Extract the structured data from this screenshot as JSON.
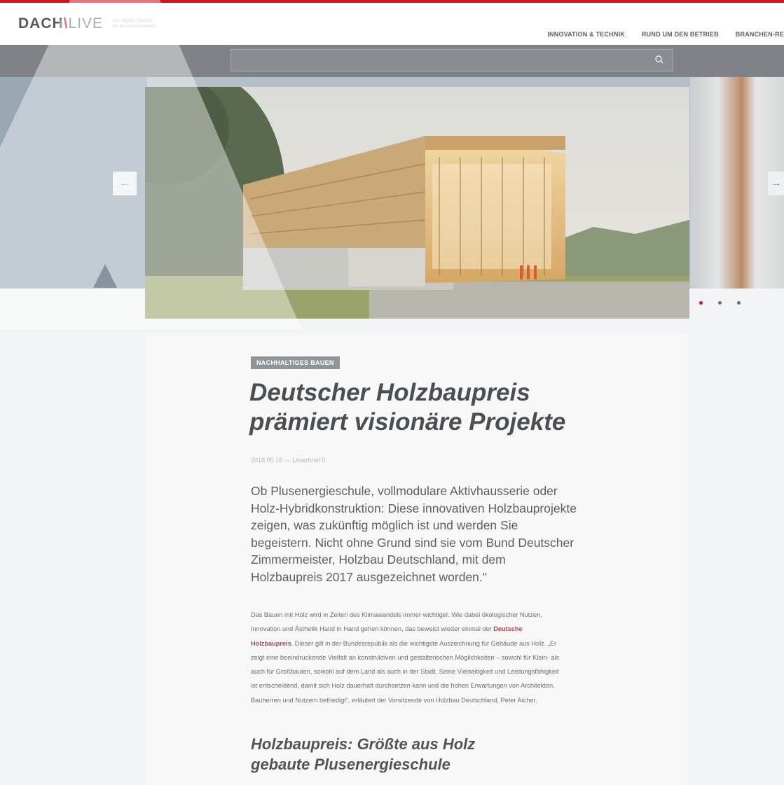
{
  "header": {
    "logo_primary": "DACH",
    "logo_slash": "\\",
    "logo_secondary": "LIVE",
    "logo_tagline_1": "Das digitale Zuhause",
    "logo_tagline_2": "für das Dachhandwerk",
    "nav": [
      {
        "label": "INNOVATION & TECHNIK"
      },
      {
        "label": "RUND UM DEN BETRIEB"
      },
      {
        "label": "BRANCHEN-RE"
      }
    ]
  },
  "search": {
    "placeholder": "",
    "value": ""
  },
  "carousel": {
    "prev_label": "←",
    "next_label": "→",
    "slides": 3,
    "active_slide": 1
  },
  "article": {
    "category": "NACHHALTIGES BAUEN",
    "title": "Deutscher Holzbaupreis prämiert visionäre Projekte",
    "date": "2018.05.18",
    "comments": "— Leserbrief 0",
    "lead": "Ob Plusenergieschule, vollmodulare Aktivhausserie oder Holz-Hybridkonstruktion: Diese innovativen Holzbauprojekte zeigen, was zukünftig möglich ist und werden Sie begeistern. Nicht ohne Grund sind sie vom Bund Deutscher Zimmermeister, Holzbau Deutschland, mit dem Holzbaupreis 2017 ausgezeichnet worden.\"",
    "body_before_link": "Das Bauen mit Holz wird in Zeiten des Klimawandels immer wichtiger. Wie dabei ökologischer Nutzen, Innovation und Ästhetik Hand in Hand gehen können, das beweist wieder einmal der ",
    "body_link": "Deutsche Holzbaupreis",
    "body_after_link": ". Dieser gilt in der Bundesrepublik als die wichtigste Auszeichnung für Gebäude aus Holz. „Er zeigt eine beeindruckende Vielfalt an konstruktiven und gestalterischen Möglichkeiten – sowohl für Klein- als auch für Großbauten, sowohl auf dem Land als auch in der Stadt. Seine Vielseitigkeit und Leistungsfähigkeit ist entscheidend, damit sich Holz dauerhaft durchsetzen kann und die hohen Erwartungen von Architekten, Bauherren und Nutzern befriedigt“, erläutert der Vorsitzende von Holzbau Deutschland, Peter Aicher.",
    "subheading": "Holzbaupreis: Größte aus Holz gebaute Plusenergieschule"
  },
  "colors": {
    "accent": "#d8111a",
    "nav_bar": "#7f8387",
    "hero_band": "#b4bfc8"
  },
  "icons": {
    "search": "search-icon",
    "prev": "arrow-left-icon",
    "next": "arrow-right-icon"
  }
}
